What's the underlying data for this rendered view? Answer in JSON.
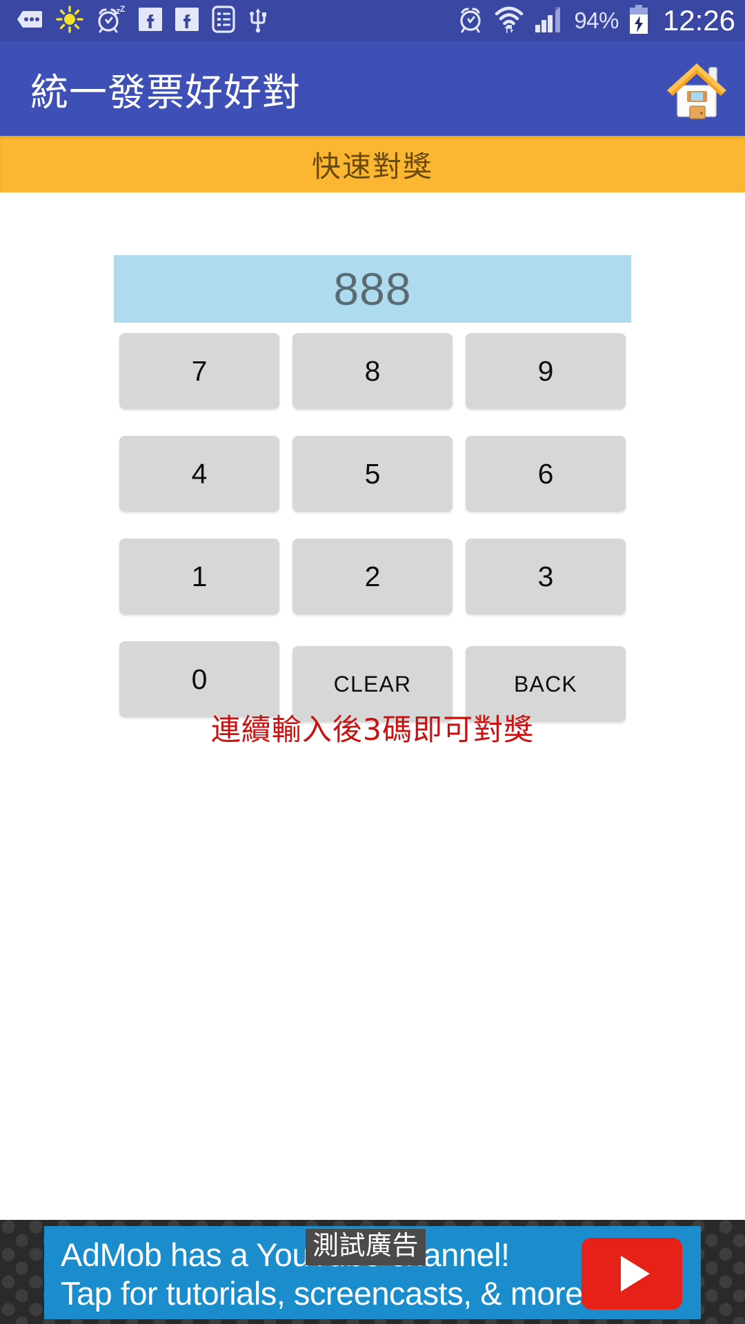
{
  "status_bar": {
    "background_color": "#3a48a4",
    "left_icons": [
      {
        "name": "message-icon",
        "label": "message"
      },
      {
        "name": "brightness-icon",
        "label": "brightness"
      },
      {
        "name": "alarm-sleep-icon",
        "label": "alarm-snooze"
      },
      {
        "name": "facebook-icon",
        "label": "facebook"
      },
      {
        "name": "facebook-icon-2",
        "label": "facebook"
      },
      {
        "name": "notes-list-icon",
        "label": "notes"
      },
      {
        "name": "usb-icon",
        "label": "usb"
      }
    ],
    "right_icons": [
      {
        "name": "alarm-icon",
        "label": "alarm"
      },
      {
        "name": "wifi-icon",
        "label": "wifi"
      },
      {
        "name": "signal-icon",
        "label": "cellular-signal"
      }
    ],
    "battery_percent": "94%",
    "battery_state": "charging",
    "clock": "12:26"
  },
  "app_bar": {
    "title": "統一發票好好對",
    "background_color": "#3e4fb5",
    "home_button_name": "home-icon"
  },
  "section_banner": {
    "label": "快速對獎",
    "background_color": "#fbb731",
    "text_color": "#6b4a12"
  },
  "display": {
    "value": "888",
    "background_color": "#aedcee",
    "text_color": "#5a6b74"
  },
  "keypad": {
    "rows": [
      [
        {
          "label": "7",
          "type": "digit"
        },
        {
          "label": "8",
          "type": "digit"
        },
        {
          "label": "9",
          "type": "digit"
        }
      ],
      [
        {
          "label": "4",
          "type": "digit"
        },
        {
          "label": "5",
          "type": "digit"
        },
        {
          "label": "6",
          "type": "digit"
        }
      ],
      [
        {
          "label": "1",
          "type": "digit"
        },
        {
          "label": "2",
          "type": "digit"
        },
        {
          "label": "3",
          "type": "digit"
        }
      ],
      [
        {
          "label": "0",
          "type": "digit"
        },
        {
          "label": "CLEAR",
          "type": "word"
        },
        {
          "label": "BACK",
          "type": "word"
        }
      ]
    ],
    "key_color": "#d6d7d7"
  },
  "hint": {
    "text": "連續輸入後3碼即可對獎",
    "color": "#cc1111"
  },
  "ad": {
    "line1": "AdMob has a YouTube channel!",
    "line2": "Tap for tutorials, screencasts, & more.",
    "test_badge": "測試廣告",
    "background_color": "#1b8dcc",
    "youtube_button_color": "#e62117"
  }
}
